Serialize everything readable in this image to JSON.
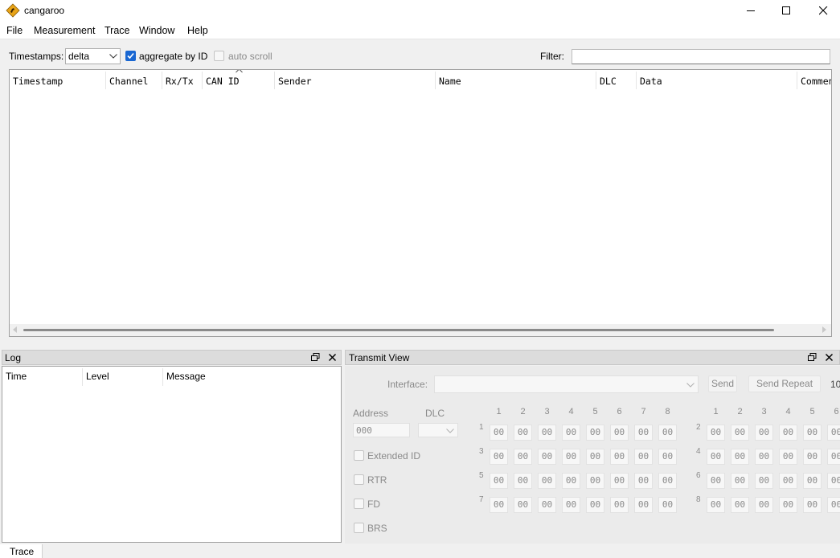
{
  "window": {
    "title": "cangaroo"
  },
  "menu": [
    "File",
    "Measurement",
    "Trace",
    "Window",
    "Help"
  ],
  "trace_toolbar": {
    "timestamps_label": "Timestamps:",
    "timestamps_value": "delta",
    "aggregate_label": "aggregate by ID",
    "aggregate_checked": true,
    "autoscroll_label": "auto scroll",
    "autoscroll_checked": false,
    "filter_label": "Filter:",
    "filter_value": ""
  },
  "trace_table": {
    "columns": [
      "Timestamp",
      "Channel",
      "Rx/Tx",
      "CAN ID",
      "Sender",
      "Name",
      "DLC",
      "Data",
      "Comment"
    ],
    "sorted_column": "CAN ID",
    "rows": []
  },
  "log_panel": {
    "title": "Log",
    "columns": [
      "Time",
      "Level",
      "Message"
    ],
    "rows": []
  },
  "transmit_panel": {
    "title": "Transmit View",
    "interface_label": "Interface:",
    "interface_value": "",
    "send_label": "Send",
    "send_repeat_label": "Send Repeat",
    "repeat_value_partial": "10",
    "address_label": "Address",
    "address_value": "000",
    "dlc_label": "DLC",
    "dlc_value": "",
    "byte_columns": [
      "1",
      "2",
      "3",
      "4",
      "5",
      "6",
      "7",
      "8"
    ],
    "byte_columns_right": [
      "1",
      "2",
      "3",
      "4",
      "5",
      "6"
    ],
    "rows_left": [
      "1",
      "3",
      "5",
      "7"
    ],
    "rows_right": [
      "2",
      "4",
      "6",
      "8"
    ],
    "byte_value": "00",
    "options": [
      {
        "label": "Extended ID",
        "checked": false
      },
      {
        "label": "RTR",
        "checked": false
      },
      {
        "label": "FD",
        "checked": false
      },
      {
        "label": "BRS",
        "checked": false
      }
    ]
  },
  "tabs": {
    "bottom": "Trace"
  },
  "colors": {
    "accent": "#1967d2",
    "disabled_text": "#8a8a8a",
    "panel_bg": "#ebebeb"
  }
}
